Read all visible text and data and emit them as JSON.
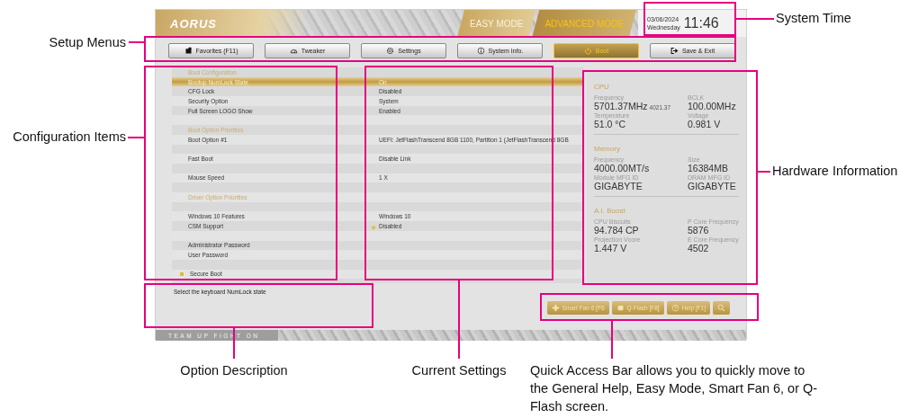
{
  "header": {
    "logo": "AORUS",
    "modes": [
      {
        "label": "EASY MODE",
        "selected": false
      },
      {
        "label": "ADVANCED MODE",
        "selected": true
      }
    ],
    "date": "03/06/2024",
    "weekday": "Wednesday",
    "time": "11:46"
  },
  "menus": [
    {
      "label": "Favorites (F11)",
      "selected": false
    },
    {
      "label": "Tweaker",
      "selected": false
    },
    {
      "label": "Settings",
      "selected": false
    },
    {
      "label": "System Info.",
      "selected": false
    },
    {
      "label": "Boot",
      "selected": true
    },
    {
      "label": "Save & Exit",
      "selected": false
    }
  ],
  "settings": [
    {
      "kind": "header",
      "label": "Boot Configuration"
    },
    {
      "kind": "item",
      "label": "Bootup NumLock State",
      "value": "On",
      "selected": true,
      "starred": false
    },
    {
      "kind": "item",
      "label": "CFG Lock",
      "value": "Disabled",
      "selected": false,
      "starred": false
    },
    {
      "kind": "item",
      "label": "Security Option",
      "value": "System",
      "selected": false,
      "starred": false
    },
    {
      "kind": "item",
      "label": "Full Screen LOGO Show",
      "value": "Enabled",
      "selected": false,
      "starred": false
    },
    {
      "kind": "blank"
    },
    {
      "kind": "header",
      "label": "Boot Option Priorities"
    },
    {
      "kind": "item",
      "label": "Boot Option #1",
      "value": "UEFI: JetFlashTranscend 8GB 1100, Partition 1 (JetFlashTranscend 8GB",
      "selected": false,
      "starred": false
    },
    {
      "kind": "blank"
    },
    {
      "kind": "item",
      "label": "Fast Boot",
      "value": "Disable Link",
      "selected": false,
      "starred": false
    },
    {
      "kind": "blank"
    },
    {
      "kind": "item",
      "label": "Mouse Speed",
      "value": "1 X",
      "selected": false,
      "starred": false
    },
    {
      "kind": "blank"
    },
    {
      "kind": "header",
      "label": "Driver Option Priorities"
    },
    {
      "kind": "blank"
    },
    {
      "kind": "item",
      "label": "Windows 10 Features",
      "value": "Windows 10",
      "selected": false,
      "starred": false
    },
    {
      "kind": "item",
      "label": "CSM Support",
      "value": "Disabled",
      "selected": false,
      "starred": true
    },
    {
      "kind": "blank"
    },
    {
      "kind": "item",
      "label": "Administrator Password",
      "selected": false,
      "starred": false
    },
    {
      "kind": "item",
      "label": "User Password",
      "selected": false,
      "starred": false
    },
    {
      "kind": "blank"
    },
    {
      "kind": "submenu",
      "label": "Secure Boot"
    }
  ],
  "hardware": [
    {
      "title": "CPU",
      "fields": [
        {
          "label": "Frequency",
          "value": "5701.37MHz",
          "sub": "4021.37"
        },
        {
          "label": "BCLK",
          "value": "100.00MHz"
        },
        {
          "label": "Temperature",
          "value": "51.0 °C"
        },
        {
          "label": "Voltage",
          "value": "0.981 V"
        }
      ]
    },
    {
      "title": "Memory",
      "fields": [
        {
          "label": "Frequency",
          "value": "4000.00MT/s"
        },
        {
          "label": "Size",
          "value": "16384MB"
        },
        {
          "label": "Module MFG ID",
          "value": "GIGABYTE"
        },
        {
          "label": "DRAM MFG ID",
          "value": "GIGABYTE"
        }
      ]
    },
    {
      "title": "A.I. Boost",
      "fields": [
        {
          "label": "CPU Biscuits",
          "value": "94.784 CP"
        },
        {
          "label": "P Core Frequency",
          "value": "5876"
        },
        {
          "label": "Projection Vcore",
          "value": "1.447 V"
        },
        {
          "label": "E Core Frequency",
          "value": "4502"
        }
      ]
    }
  ],
  "description": "Select the keyboard NumLock state",
  "quick_access": [
    {
      "kind": "button",
      "label": "Smart Fan 6 [F6"
    },
    {
      "kind": "button",
      "label": "Q-Flash [F8]"
    },
    {
      "kind": "button",
      "label": "Help [F1]"
    },
    {
      "kind": "search"
    }
  ],
  "slogan": "TEAM UP FIGHT ON",
  "callouts": [
    {
      "label": "System Time"
    },
    {
      "label": "Setup Menus"
    },
    {
      "label": "Configuration Items"
    },
    {
      "label": "Hardware Information"
    },
    {
      "label": "Option Description"
    },
    {
      "label": "Current Settings"
    },
    {
      "label": "Quick Access Bar allows you to quickly move to the General Help, Easy Mode, Smart Fan 6, or Q-Flash screen."
    }
  ]
}
